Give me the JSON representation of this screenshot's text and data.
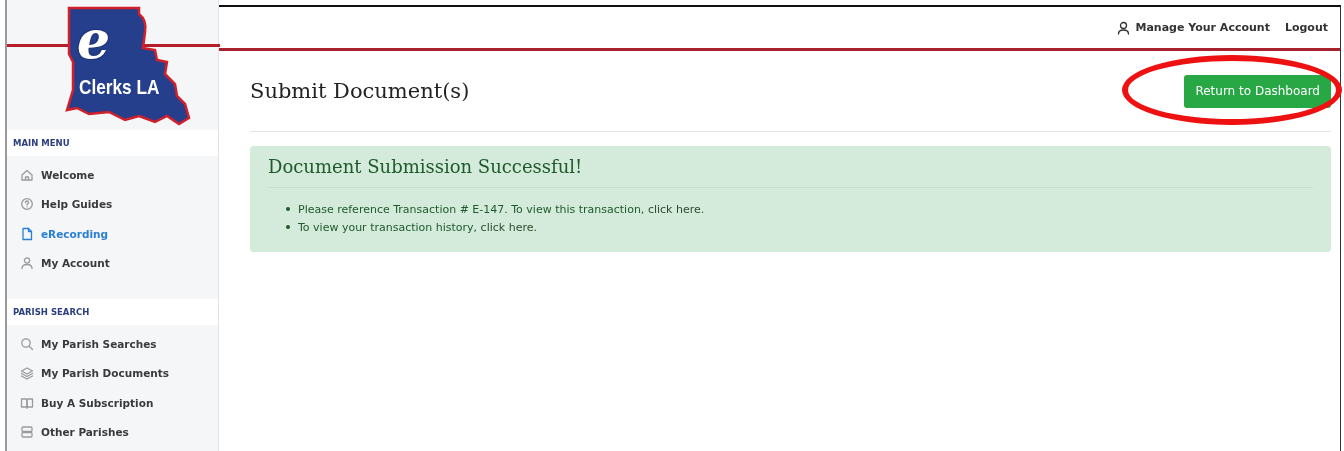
{
  "logo": {
    "letter": "e",
    "text": "Clerks LA"
  },
  "header": {
    "account_link": "Manage Your Account",
    "logout_link": "Logout"
  },
  "sidebar": {
    "sections": [
      {
        "title": "MAIN MENU",
        "items": [
          {
            "label": "Welcome",
            "selected": false
          },
          {
            "label": "Help Guides",
            "selected": false
          },
          {
            "label": "eRecording",
            "selected": true
          },
          {
            "label": "My Account",
            "selected": false
          }
        ]
      },
      {
        "title": "PARISH SEARCH",
        "items": [
          {
            "label": "My Parish Searches",
            "selected": false
          },
          {
            "label": "My Parish Documents",
            "selected": false
          },
          {
            "label": "Buy A Subscription",
            "selected": false
          },
          {
            "label": "Other Parishes",
            "selected": false
          }
        ]
      }
    ]
  },
  "page": {
    "title": "Submit Document(s)",
    "button": "Return to Dashboard",
    "button_highlighted": true
  },
  "alert": {
    "title": "Document Submission Successful!",
    "lines": [
      {
        "before": "Please reference Transaction # E-147. To view this transaction, ",
        "link": "click here",
        "after": "."
      },
      {
        "before": "To view your transaction history, ",
        "link": "click here",
        "after": "."
      }
    ]
  }
}
